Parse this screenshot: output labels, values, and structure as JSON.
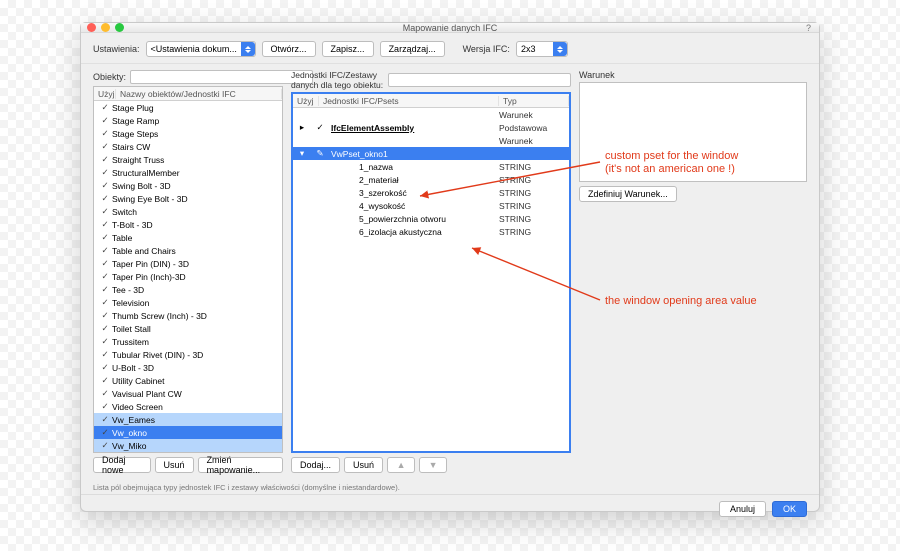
{
  "window": {
    "title": "Mapowanie danych IFC",
    "help": "?"
  },
  "toolbar": {
    "settings_label": "Ustawienia:",
    "settings_value": "<Ustawienia dokum...",
    "open_label": "Otwórz...",
    "save_label": "Zapisz...",
    "manage_label": "Zarządzaj...",
    "version_label": "Wersja IFC:",
    "version_value": "2x3"
  },
  "leftcol": {
    "title": "Obiekty:",
    "header_use": "Użyj",
    "header_name": "Nazwy obiektów/Jednostki IFC",
    "items": [
      "Stage Plug",
      "Stage Ramp",
      "Stage Steps",
      "Stairs CW",
      "Straight Truss",
      "StructuralMember",
      "Swing Bolt - 3D",
      "Swing Eye Bolt - 3D",
      "Switch",
      "T-Bolt - 3D",
      "Table",
      "Table and Chairs",
      "Taper Pin (DIN) - 3D",
      "Taper Pin (Inch)-3D",
      "Tee - 3D",
      "Television",
      "Thumb Screw (Inch) - 3D",
      "Toilet Stall",
      "Trussitem",
      "Tubular Rivet (DIN) - 3D",
      "U-Bolt - 3D",
      "Utility Cabinet",
      "Vavisual Plant CW",
      "Video Screen",
      "Vw_Eames",
      "Vw_okno",
      "Vw_Miko"
    ],
    "selected_index": 25,
    "btn_add": "Dodaj nowe",
    "btn_del": "Usuń",
    "btn_map": "Zmień mapowanie..."
  },
  "midcol": {
    "title": "Jednostki IFC/Zestawy danych dla tego obiektu:",
    "header_use": "Użyj",
    "header_name": "Jednostki IFC/Psets",
    "header_type": "Typ",
    "assembly_row": {
      "name": "IfcElementAssembly",
      "types": [
        "Warunek",
        "Podstawowa",
        "Warunek"
      ]
    },
    "pset_row": {
      "name": "VwPset_okno1"
    },
    "fields": [
      {
        "name": "1_nazwa",
        "type": "STRING"
      },
      {
        "name": "2_materiał",
        "type": "STRING"
      },
      {
        "name": "3_szerokość",
        "type": "STRING"
      },
      {
        "name": "4_wysokość",
        "type": "STRING"
      },
      {
        "name": "5_powierzchnia otworu",
        "type": "STRING"
      },
      {
        "name": "6_izolacja akustyczna",
        "type": "STRING"
      }
    ],
    "btn_add": "Dodaj...",
    "btn_del": "Usuń",
    "btn_up": "▲",
    "btn_down": "▼"
  },
  "rightcol": {
    "title": "Warunek",
    "btn_define": "Zdefiniuj Warunek..."
  },
  "footer_text": "Lista pól obejmująca typy jednostek IFC i zestawy właściwości (domyślne i niestandardowe).",
  "footbtns": {
    "cancel": "Anuluj",
    "ok": "OK"
  },
  "annotations": {
    "a1": "custom pset for the window\n(it's not an american one !)",
    "a2": "the window opening area value"
  }
}
